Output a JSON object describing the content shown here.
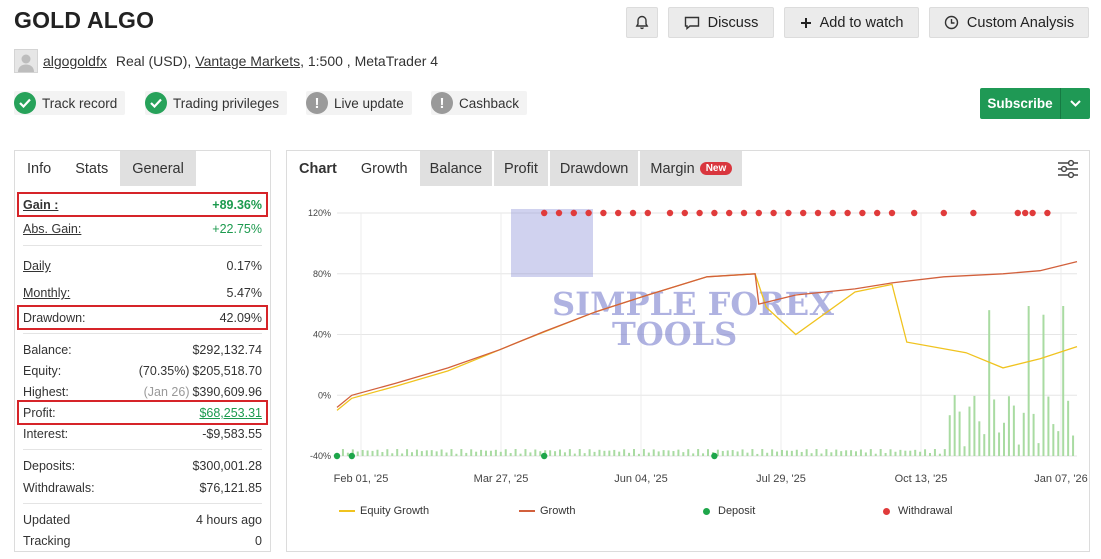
{
  "title": "GOLD ALGO",
  "actions": {
    "discuss": "Discuss",
    "add_to_watch": "Add to watch",
    "custom_analysis": "Custom Analysis"
  },
  "account": {
    "user": "algogoldfx",
    "type": "Real (USD),",
    "broker": "Vantage Markets",
    "leverage_platform": ", 1:500 , MetaTrader 4"
  },
  "badges": [
    "Track record",
    "Trading privileges",
    "Live update",
    "Cashback"
  ],
  "subscribe": "Subscribe",
  "left_tabs": [
    "Info",
    "Stats",
    "General"
  ],
  "stats": {
    "gain": {
      "k": "Gain :",
      "v": "+89.36%"
    },
    "abs_gain": {
      "k": "Abs. Gain:",
      "v": "+22.75%"
    },
    "daily": {
      "k": "Daily",
      "v": "0.17%"
    },
    "monthly": {
      "k": "Monthly:",
      "v": "5.47%"
    },
    "drawdown": {
      "k": "Drawdown:",
      "v": "42.09%"
    },
    "balance": {
      "k": "Balance:",
      "v": "$292,132.74"
    },
    "equity": {
      "k": "Equity:",
      "sub": "(70.35%)",
      "v": "$205,518.70"
    },
    "highest": {
      "k": "Highest:",
      "sub": "(Jan 26)",
      "v": "$390,609.96"
    },
    "profit": {
      "k": "Profit:",
      "v": "$68,253.31"
    },
    "interest": {
      "k": "Interest:",
      "v": "-$9,583.55"
    },
    "deposits": {
      "k": "Deposits:",
      "v": "$300,001.28"
    },
    "withdrawals": {
      "k": "Withdrawals:",
      "v": "$76,121.85"
    },
    "updated": {
      "k": "Updated",
      "v": "4 hours ago"
    },
    "tracking": {
      "k": "Tracking",
      "v": "0"
    }
  },
  "chart_tabs": {
    "label": "Chart",
    "items": [
      "Growth",
      "Balance",
      "Profit",
      "Drawdown",
      "Margin"
    ],
    "new_badge": "New"
  },
  "watermark": {
    "line1": "SIMPLE FOREX",
    "line2": "TOOLS"
  },
  "colors": {
    "growth": "#d2603c",
    "equity": "#f0c31f",
    "deposit": "#1ea64a",
    "withdrawal": "#e03b3b",
    "bars": "#a9dba2",
    "accent_green": "#1f9955",
    "highlight": "#d62429"
  },
  "chart_data": {
    "type": "line",
    "y_ticks": [
      "120%",
      "80%",
      "40%",
      "0%",
      "-40%"
    ],
    "ylim": [
      -40,
      120
    ],
    "x_ticks": [
      "Feb 01, '25",
      "Mar 27, '25",
      "Jun 04, '25",
      "Jul 29, '25",
      "Oct 13, '25",
      "Jan 07, '26"
    ],
    "legend": [
      "Equity Growth",
      "Growth",
      "Deposit",
      "Withdrawal"
    ],
    "series": [
      {
        "name": "Growth",
        "x": [
          0,
          0.02,
          0.08,
          0.15,
          0.22,
          0.28,
          0.35,
          0.42,
          0.5,
          0.565,
          0.57,
          0.62,
          0.7,
          0.75,
          0.82,
          0.9,
          0.95,
          1.0
        ],
        "y": [
          -8,
          0,
          8,
          18,
          30,
          42,
          55,
          66,
          78,
          80,
          60,
          66,
          70,
          74,
          78,
          80,
          82,
          88
        ]
      },
      {
        "name": "Equity Growth",
        "x": [
          0,
          0.02,
          0.08,
          0.15,
          0.2,
          0.25,
          0.35,
          0.42,
          0.5,
          0.565,
          0.58,
          0.62,
          0.7,
          0.75,
          0.77,
          0.85,
          0.9,
          0.95,
          1.0
        ],
        "y": [
          -10,
          -2,
          6,
          16,
          26,
          36,
          55,
          66,
          78,
          80,
          58,
          40,
          68,
          73,
          35,
          28,
          18,
          24,
          32
        ]
      }
    ],
    "deposits_x": [
      0.0,
      0.02,
      0.28,
      0.51
    ],
    "withdrawals_x": [
      0.28,
      0.3,
      0.32,
      0.34,
      0.36,
      0.38,
      0.4,
      0.42,
      0.45,
      0.47,
      0.49,
      0.51,
      0.53,
      0.55,
      0.57,
      0.59,
      0.61,
      0.63,
      0.65,
      0.67,
      0.69,
      0.71,
      0.73,
      0.75,
      0.78,
      0.82,
      0.86,
      0.92,
      0.93,
      0.94,
      0.96
    ]
  }
}
